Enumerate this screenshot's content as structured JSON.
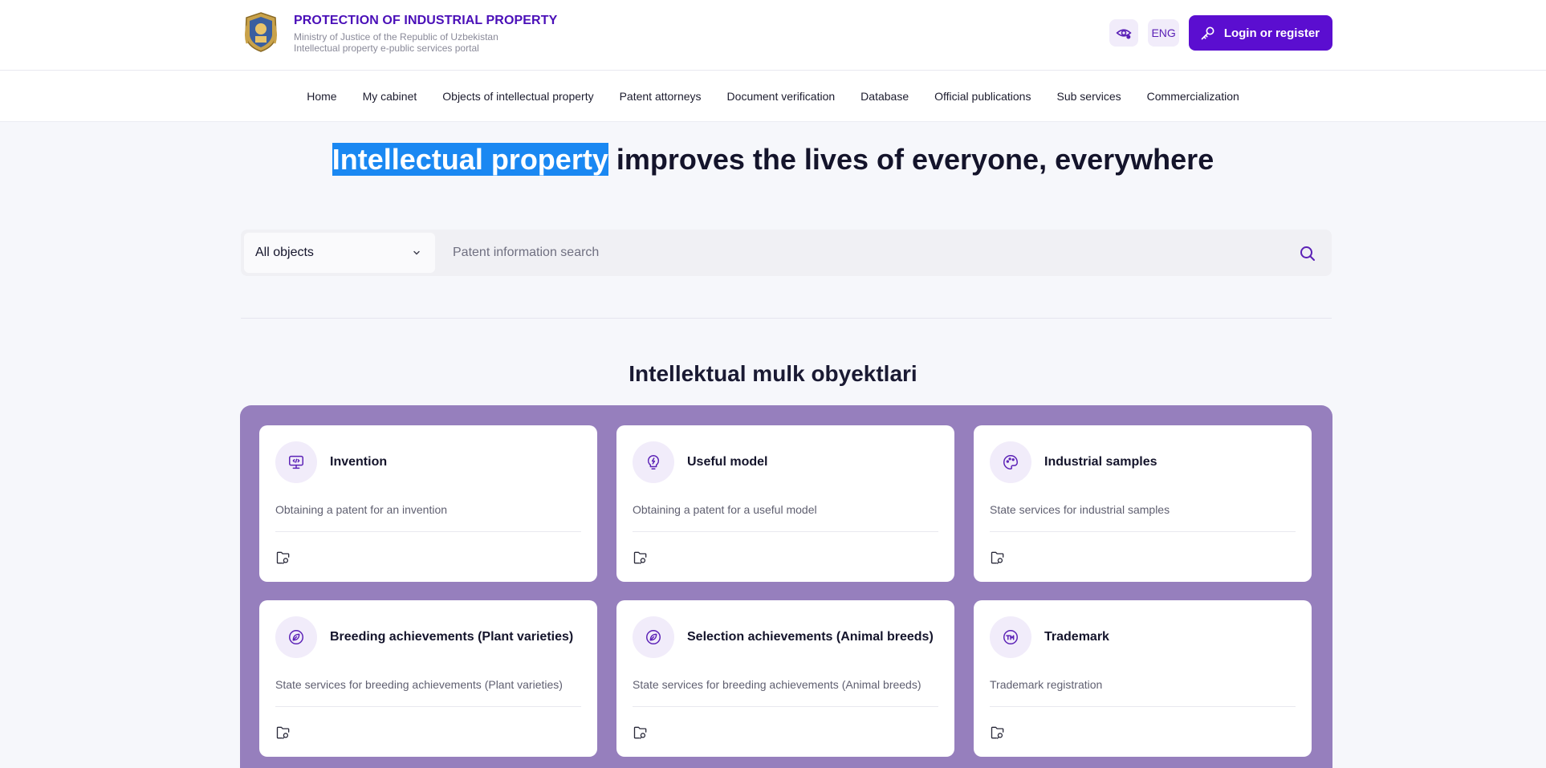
{
  "header": {
    "title": "PROTECTION OF INDUSTRIAL PROPERTY",
    "subtitle1": "Ministry of Justice of the Republic of Uzbekistan",
    "subtitle2": "Intellectual property e-public services portal",
    "language": "ENG",
    "login_label": "Login or register",
    "accent_color": "#5b0ed0"
  },
  "nav": {
    "items": [
      "Home",
      "My cabinet",
      "Objects of intellectual property",
      "Patent attorneys",
      "Document verification",
      "Database",
      "Official publications",
      "Sub services",
      "Commercialization"
    ]
  },
  "hero": {
    "highlight": "Intellectual property",
    "rest": " improves the lives of everyone, everywhere"
  },
  "search": {
    "select_value": "All objects",
    "placeholder": "Patent information search"
  },
  "section": {
    "title": "Intellektual mulk obyektlari"
  },
  "cards": [
    {
      "title": "Invention",
      "desc": "Obtaining a patent for an invention",
      "icon": "monitor-code-icon"
    },
    {
      "title": "Useful model",
      "desc": "Obtaining a patent for a useful model",
      "icon": "bulb-bolt-icon"
    },
    {
      "title": "Industrial samples",
      "desc": "State services for industrial samples",
      "icon": "palette-icon"
    },
    {
      "title": "Breeding achievements (Plant varieties)",
      "desc": "State services for breeding achievements (Plant varieties)",
      "icon": "leaf-icon"
    },
    {
      "title": "Selection achievements (Animal breeds)",
      "desc": "State services for breeding achievements (Animal breeds)",
      "icon": "leaf-icon"
    },
    {
      "title": "Trademark",
      "desc": "Trademark registration",
      "icon": "trademark-icon"
    }
  ]
}
